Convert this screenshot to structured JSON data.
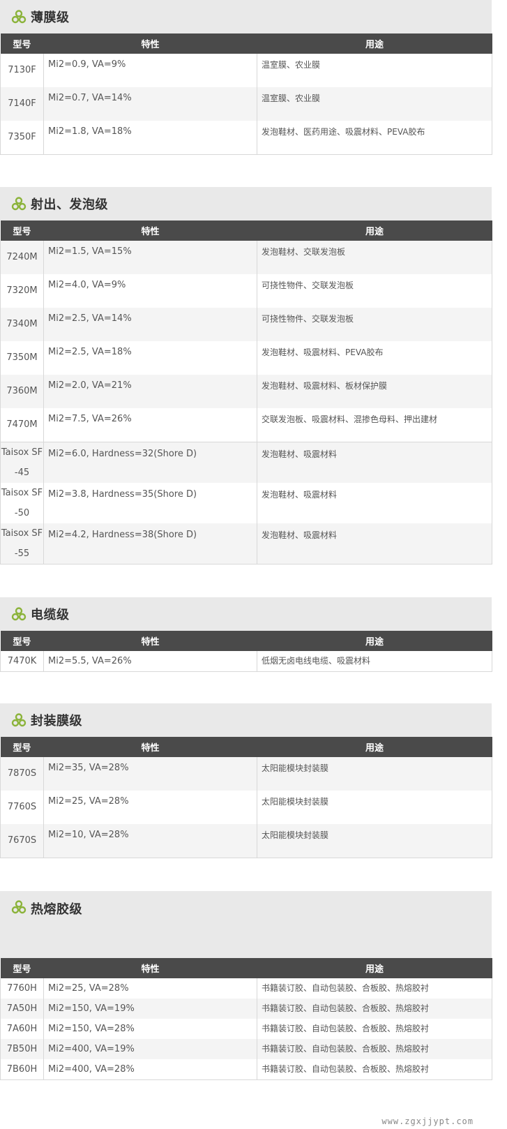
{
  "headers": {
    "model": "型号",
    "property": "特性",
    "use": "用途"
  },
  "sections": [
    {
      "title": "薄膜级",
      "rows": [
        {
          "model": "7130F",
          "property": "Mi2=0.9, VA=9%",
          "use": "温室膜、农业膜"
        },
        {
          "model": "7140F",
          "property": "Mi2=0.7, VA=14%",
          "use": "温室膜、农业膜"
        },
        {
          "model": "7350F",
          "property": "Mi2=1.8, VA=18%",
          "use": "发泡鞋材、医药用途、吸震材料、PEVA胶布"
        }
      ]
    },
    {
      "title": "射出、发泡级",
      "rows": [
        {
          "model": "7240M",
          "property": "Mi2=1.5, VA=15%",
          "use": "发泡鞋材、交联发泡板"
        },
        {
          "model": "7320M",
          "property": "Mi2=4.0, VA=9%",
          "use": "可挠性物件、交联发泡板"
        },
        {
          "model": "7340M",
          "property": "Mi2=2.5, VA=14%",
          "use": "可挠性物件、交联发泡板"
        },
        {
          "model": "7350M",
          "property": "Mi2=2.5, VA=18%",
          "use": "发泡鞋材、吸震材料、PEVA胶布"
        },
        {
          "model": "7360M",
          "property": "Mi2=2.0, VA=21%",
          "use": "发泡鞋材、吸震材料、板材保护膜"
        },
        {
          "model": "7470M",
          "property": "Mi2=7.5, VA=26%",
          "use": "交联发泡板、吸震材料、混掺色母料、押出建材"
        },
        {
          "model": "Taisox SF-45",
          "property": "Mi2=6.0, Hardness=32(Shore D)",
          "use": "发泡鞋材、吸震材料"
        },
        {
          "model": "Taisox SF-50",
          "property": "Mi2=3.8, Hardness=35(Shore D)",
          "use": "发泡鞋材、吸震材料"
        },
        {
          "model": "Taisox SF-55",
          "property": "Mi2=4.2, Hardness=38(Shore D)",
          "use": "发泡鞋材、吸震材料"
        }
      ]
    },
    {
      "title": "电缆级",
      "rows": [
        {
          "model": "7470K",
          "property": "Mi2=5.5, VA=26%",
          "use": "低烟无卤电线电缆、吸震材料"
        }
      ]
    },
    {
      "title": "封装膜级",
      "rows": [
        {
          "model": "7870S",
          "property": "Mi2=35, VA=28%",
          "use": "太阳能模块封装膜"
        },
        {
          "model": "7760S",
          "property": "Mi2=25, VA=28%",
          "use": "太阳能模块封装膜"
        },
        {
          "model": "7670S",
          "property": "Mi2=10, VA=28%",
          "use": "太阳能模块封装膜"
        }
      ]
    },
    {
      "title": "热熔胶级",
      "rows": [
        {
          "model": "7760H",
          "property": "Mi2=25, VA=28%",
          "use": "书籍装订胶、自动包装胶、合板胶、热熔胶衬"
        },
        {
          "model": "7A50H",
          "property": "Mi2=150, VA=19%",
          "use": "书籍装订胶、自动包装胶、合板胶、热熔胶衬"
        },
        {
          "model": "7A60H",
          "property": "Mi2=150, VA=28%",
          "use": "书籍装订胶、自动包装胶、合板胶、热熔胶衬"
        },
        {
          "model": "7B50H",
          "property": "Mi2=400, VA=19%",
          "use": "书籍装订胶、自动包装胶、合板胶、热熔胶衬"
        },
        {
          "model": "7B60H",
          "property": "Mi2=400, VA=28%",
          "use": "书籍装订胶、自动包装胶、合板胶、热熔胶衬"
        }
      ]
    }
  ],
  "watermark": "www.zgxjjypt.com",
  "colors": {
    "icon_green": "#8bb33a",
    "header_bg": "#4a4a4a",
    "section_bg": "#e9e9e9"
  }
}
